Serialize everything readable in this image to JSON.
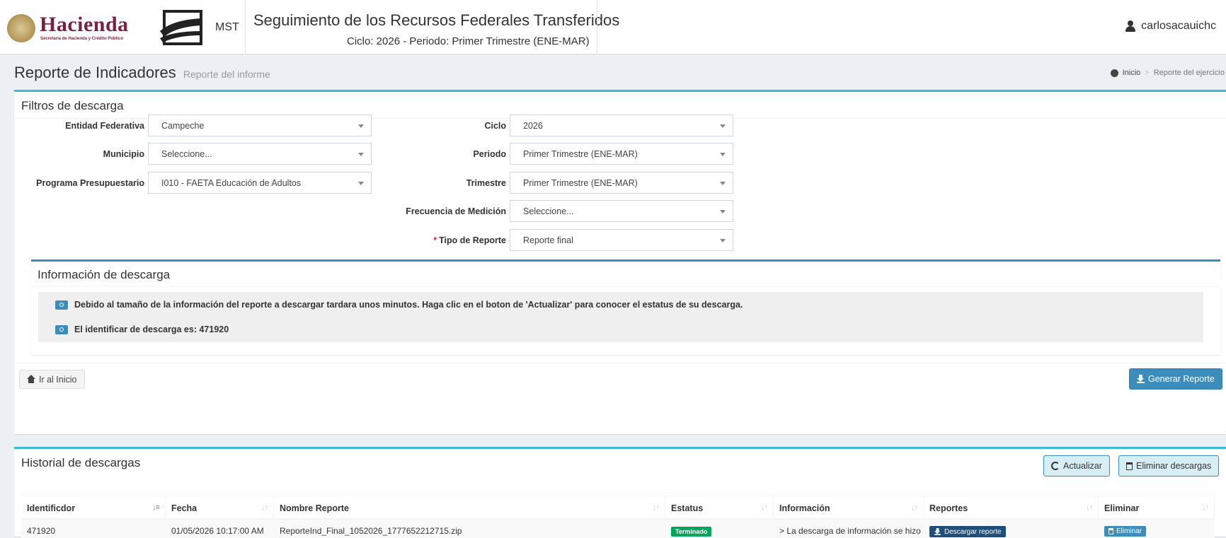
{
  "header": {
    "logo_name": "Hacienda",
    "logo_sub": "Secretaría de Hacienda y Crédito Público",
    "mst_label": "MST",
    "system_title": "Seguimiento de los Recursos Federales Transferidos",
    "cycle_period": "Ciclo: 2026 - Periodo: Primer Trimestre (ENE-MAR)",
    "username": "carlosacauichc"
  },
  "page": {
    "title": "Reporte de Indicadores",
    "subtitle": "Reporte del informe",
    "breadcrumb": {
      "home": "Inicio",
      "current": "Reporte del ejercicio"
    }
  },
  "filters": {
    "title": "Filtros de descarga",
    "entidad": {
      "label": "Entidad Federativa",
      "value": "Campeche"
    },
    "municipio": {
      "label": "Municipio",
      "value": "Seleccione..."
    },
    "programa": {
      "label": "Programa Presupuestario",
      "value": "I010 - FAETA Educación de Adultos"
    },
    "ciclo": {
      "label": "Ciclo",
      "value": "2026"
    },
    "periodo": {
      "label": "Periodo",
      "value": "Primer Trimestre (ENE-MAR)"
    },
    "trimestre": {
      "label": "Trimestre",
      "value": "Primer Trimestre (ENE-MAR)"
    },
    "frecuencia": {
      "label": "Frecuencia de Medición",
      "value": "Seleccione..."
    },
    "tipo": {
      "required_mark": "*",
      "label": "Tipo de Reporte",
      "value": "Reporte final"
    }
  },
  "info": {
    "title": "Información de descarga",
    "message1": "Debido al tamaño de la información del reporte a descargar tardara unos minutos. Haga clic en el boton de 'Actualizar' para conocer el estatus de su descarga.",
    "message2": "El identificar de descarga es: 471920"
  },
  "actions": {
    "home_button": "Ir al Inicio",
    "generate_button": "Generar Reporte"
  },
  "history": {
    "title": "Historial de descargas",
    "refresh_button": "Actualizar",
    "delete_all_button": "Eliminar descargas",
    "columns": [
      "Identificdor",
      "Fecha",
      "Nombre Reporte",
      "Estatus",
      "Información",
      "Reportes",
      "Eliminar"
    ],
    "rows": [
      {
        "id": "471920",
        "date": "01/05/2026 10:17:00 AM",
        "name": "ReporteInd_Final_1052026_1777652212715.zip",
        "status": "Terminado",
        "info": "> La descarga de información se hizo",
        "download": "Descargar reporte",
        "delete": "Eliminar"
      }
    ]
  },
  "colors": {
    "accent_teal": "#3cbcd4",
    "primary_blue": "#3c8dbc",
    "success_green": "#00a65a",
    "brand_maroon": "#7a1f3d"
  }
}
